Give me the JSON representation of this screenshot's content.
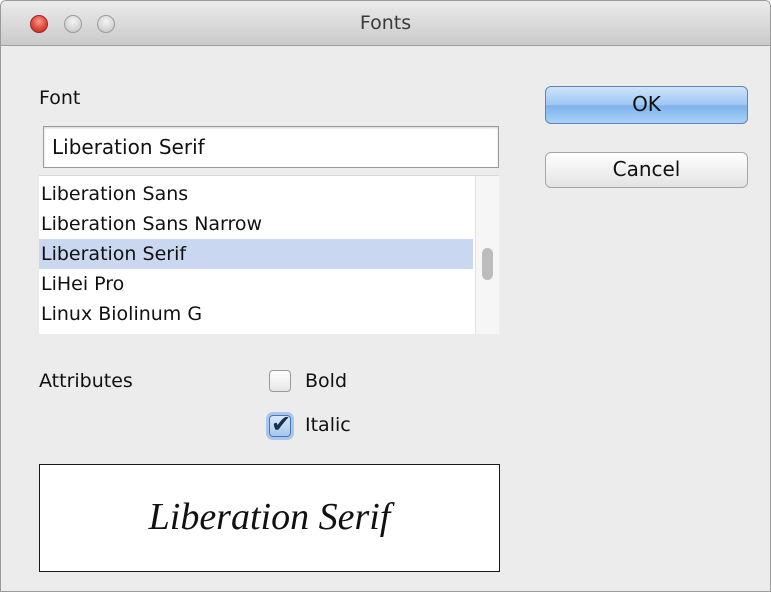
{
  "window": {
    "title": "Fonts"
  },
  "font_label": "Font",
  "font_input_value": "Liberation Serif",
  "font_list": {
    "items": [
      {
        "label": "Liberation Sans",
        "selected": false
      },
      {
        "label": "Liberation Sans Narrow",
        "selected": false
      },
      {
        "label": "Liberation Serif",
        "selected": true
      },
      {
        "label": "LiHei Pro",
        "selected": false
      },
      {
        "label": "Linux Biolinum G",
        "selected": false
      }
    ]
  },
  "buttons": {
    "ok_label": "OK",
    "cancel_label": "Cancel"
  },
  "attributes": {
    "label": "Attributes",
    "bold": {
      "label": "Bold",
      "checked": false
    },
    "italic": {
      "label": "Italic",
      "checked": true
    }
  },
  "preview": {
    "text": "Liberation Serif"
  },
  "colors": {
    "selection": "#c9d7f0",
    "ok_button": "#9cc7f3",
    "close_button": "#e0463a"
  },
  "icons": {
    "close": "close-traffic-light-icon",
    "minimize": "minimize-traffic-light-icon",
    "zoom": "zoom-traffic-light-icon",
    "check": "checkmark-icon"
  }
}
